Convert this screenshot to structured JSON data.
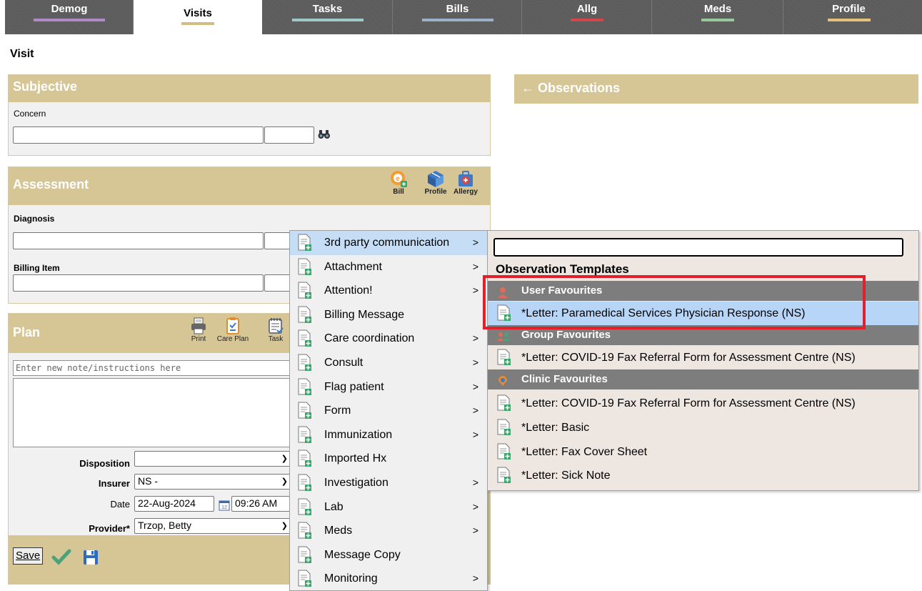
{
  "tabs": [
    {
      "label": "Demog",
      "color": "#b08ac6",
      "active": false
    },
    {
      "label": "Visits",
      "color": "#d2bd84",
      "active": true
    },
    {
      "label": "Tasks",
      "color": "#9ec9c7",
      "active": false
    },
    {
      "label": "Bills",
      "color": "#9ab0c9",
      "active": false
    },
    {
      "label": "Allg",
      "color": "#d2464a",
      "active": false
    },
    {
      "label": "Meds",
      "color": "#98c99b",
      "active": false
    },
    {
      "label": "Profile",
      "color": "#e6bf7a",
      "active": false
    }
  ],
  "page_title": "Visit",
  "subjective": {
    "title": "Subjective",
    "concern_label": "Concern"
  },
  "assessment": {
    "title": "Assessment",
    "diagnosis_label": "Diagnosis",
    "billing_label": "Billing Item",
    "actions": {
      "bill": "Bill",
      "profile": "Profile",
      "allergy": "Allergy"
    }
  },
  "plan": {
    "title": "Plan",
    "actions": {
      "print": "Print",
      "care_plan": "Care Plan",
      "task": "Task"
    },
    "note_placeholder": "Enter new note/instructions here",
    "disposition_label": "Disposition",
    "disposition_value": "",
    "insurer_label": "Insurer",
    "insurer_value": "NS -",
    "date_label": "Date",
    "date_value": "22-Aug-2024",
    "time_value": "09:26 AM",
    "provider_label": "Provider*",
    "provider_value": "Trzop, Betty",
    "save_label": "Save"
  },
  "observations": {
    "title": "Observations"
  },
  "menu": {
    "items": [
      {
        "label": "3rd party communication",
        "submenu": true,
        "highlighted": true
      },
      {
        "label": "Attachment",
        "submenu": true
      },
      {
        "label": "Attention!",
        "submenu": true
      },
      {
        "label": "Billing Message",
        "submenu": false
      },
      {
        "label": "Care coordination",
        "submenu": true
      },
      {
        "label": "Consult",
        "submenu": true
      },
      {
        "label": "Flag patient",
        "submenu": true
      },
      {
        "label": "Form",
        "submenu": true
      },
      {
        "label": "Immunization",
        "submenu": true
      },
      {
        "label": "Imported Hx",
        "submenu": false
      },
      {
        "label": "Investigation",
        "submenu": true
      },
      {
        "label": "Lab",
        "submenu": true
      },
      {
        "label": "Meds",
        "submenu": true
      },
      {
        "label": "Message Copy",
        "submenu": false
      },
      {
        "label": "Monitoring",
        "submenu": true
      }
    ]
  },
  "submenu": {
    "search_value": "",
    "title": "Observation Templates",
    "user_favourites_label": "User Favourites",
    "user_favourites": [
      "*Letter: Paramedical Services Physician Response (NS)"
    ],
    "group_favourites_label": "Group Favourites",
    "group_favourites": [
      "*Letter: COVID-19 Fax Referral Form for Assessment Centre (NS)"
    ],
    "clinic_favourites_label": "Clinic Favourites",
    "clinic_favourites": [
      "*Letter: COVID-19 Fax Referral Form for Assessment Centre (NS)",
      "*Letter: Basic",
      "*Letter: Fax Cover Sheet",
      "*Letter: Sick Note"
    ]
  },
  "colors": {
    "panel_header": "#d6c595",
    "highlight": "#b7d6f7",
    "red_box": "#e0212c",
    "save_check": "#4aa37a",
    "save_disk": "#2f6cbf"
  }
}
